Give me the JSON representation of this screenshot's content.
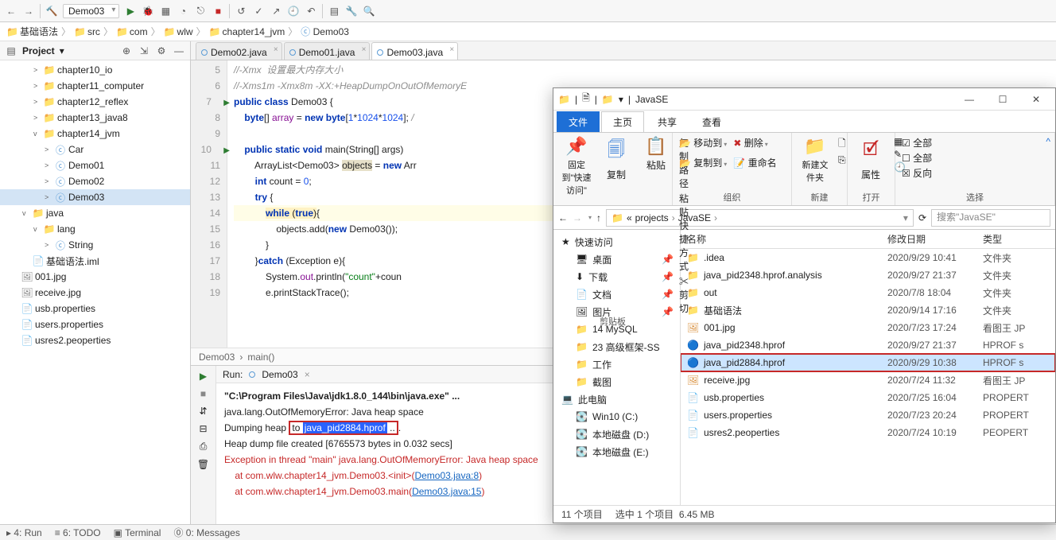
{
  "toolbar": {
    "run_config": "Demo03"
  },
  "breadcrumbs": [
    "基础语法",
    "src",
    "com",
    "wlw",
    "chapter14_jvm",
    "Demo03"
  ],
  "project": {
    "title": "Project",
    "tree": [
      {
        "depth": 3,
        "arrow": ">",
        "icon": "📁",
        "label": "chapter10_io"
      },
      {
        "depth": 3,
        "arrow": ">",
        "icon": "📁",
        "label": "chapter11_computer"
      },
      {
        "depth": 3,
        "arrow": ">",
        "icon": "📁",
        "label": "chapter12_reflex"
      },
      {
        "depth": 3,
        "arrow": ">",
        "icon": "📁",
        "label": "chapter13_java8"
      },
      {
        "depth": 3,
        "arrow": "v",
        "icon": "📁",
        "label": "chapter14_jvm"
      },
      {
        "depth": 4,
        "arrow": ">",
        "icon": "ⓒ",
        "label": "Car"
      },
      {
        "depth": 4,
        "arrow": ">",
        "icon": "ⓒ",
        "label": "Demo01"
      },
      {
        "depth": 4,
        "arrow": ">",
        "icon": "ⓒ",
        "label": "Demo02"
      },
      {
        "depth": 4,
        "arrow": ">",
        "icon": "ⓒ",
        "label": "Demo03",
        "sel": true
      },
      {
        "depth": 2,
        "arrow": "v",
        "icon": "📁",
        "label": "java"
      },
      {
        "depth": 3,
        "arrow": "v",
        "icon": "📁",
        "label": "lang"
      },
      {
        "depth": 4,
        "arrow": ">",
        "icon": "ⓒ",
        "label": "String"
      },
      {
        "depth": 2,
        "arrow": "",
        "icon": "📄",
        "label": "基础语法.iml"
      },
      {
        "depth": 1,
        "arrow": "",
        "icon": "🖼",
        "label": "001.jpg"
      },
      {
        "depth": 1,
        "arrow": "",
        "icon": "🖼",
        "label": "receive.jpg"
      },
      {
        "depth": 1,
        "arrow": "",
        "icon": "📄",
        "label": "usb.properties"
      },
      {
        "depth": 1,
        "arrow": "",
        "icon": "📄",
        "label": "users.properties"
      },
      {
        "depth": 1,
        "arrow": "",
        "icon": "📄",
        "label": "usres2.peoperties"
      }
    ]
  },
  "editor": {
    "tabs": [
      {
        "label": "Demo02.java"
      },
      {
        "label": "Demo01.java"
      },
      {
        "label": "Demo03.java",
        "active": true
      }
    ],
    "gutter_start": 5,
    "gutter_count": 15,
    "crumb": [
      "Demo03",
      "main()"
    ]
  },
  "run": {
    "title": "Run:",
    "config": "Demo03",
    "lines": [
      {
        "cls": "",
        "html": "<b>\"C:\\Program Files\\Java\\jdk1.8.0_144\\bin\\java.exe\" ...</b>"
      },
      {
        "cls": "",
        "html": "java.lang.OutOfMemoryError: Java heap space"
      },
      {
        "cls": "",
        "html": "Dumping heap <span class='boxed'>to <span class='sel-text'>java_pid2884.hprof</span> ..</span>."
      },
      {
        "cls": "",
        "html": "Heap dump file created [6765573 bytes in 0.032 secs]"
      },
      {
        "cls": "red",
        "html": "Exception in thread \"main\" java.lang.OutOfMemoryError: Java heap space"
      },
      {
        "cls": "red",
        "html": "    at com.wlw.chapter14_jvm.Demo03.&lt;init&gt;(<span class='link'>Demo03.java:8</span>)"
      },
      {
        "cls": "red",
        "html": "    at com.wlw.chapter14_jvm.Demo03.main(<span class='link'>Demo03.java:15</span>)"
      }
    ]
  },
  "explorer": {
    "title": "JavaSE",
    "ribbon_tabs": [
      "文件",
      "主页",
      "共享",
      "查看"
    ],
    "ribbon_groups": {
      "clipboard": {
        "pin": "固定到\"快速访问\"",
        "copy": "复制",
        "paste": "粘贴",
        "cp_path": "复制路径",
        "paste_sc": "粘贴快捷方式",
        "cut": "剪切",
        "label": "剪贴板"
      },
      "organize": {
        "move": "移动到",
        "copy_to": "复制到",
        "delete": "删除",
        "rename": "重命名",
        "label": "组织"
      },
      "new": {
        "folder": "新建文件夹",
        "label": "新建"
      },
      "open": {
        "props": "属性",
        "label": "打开"
      },
      "select": {
        "all": "全部",
        "none": "全部",
        "inv": "反向",
        "label": "选择"
      }
    },
    "path": [
      "« ",
      "projects",
      "JavaSE"
    ],
    "search_placeholder": "搜索\"JavaSE\"",
    "side": [
      {
        "icon": "★",
        "label": "快速访问",
        "indent": false
      },
      {
        "icon": "🖥",
        "label": "桌面",
        "indent": true,
        "pin": true
      },
      {
        "icon": "⬇",
        "label": "下载",
        "indent": true,
        "pin": true
      },
      {
        "icon": "📄",
        "label": "文档",
        "indent": true,
        "pin": true
      },
      {
        "icon": "🖼",
        "label": "图片",
        "indent": true,
        "pin": true
      },
      {
        "icon": "📁",
        "label": "14 MySQL",
        "indent": true
      },
      {
        "icon": "📁",
        "label": "23 高级框架-SS",
        "indent": true
      },
      {
        "icon": "📁",
        "label": "工作",
        "indent": true
      },
      {
        "icon": "📁",
        "label": "截图",
        "indent": true
      },
      {
        "icon": "💻",
        "label": "此电脑",
        "indent": false
      },
      {
        "icon": "💽",
        "label": "Win10 (C:)",
        "indent": true
      },
      {
        "icon": "💽",
        "label": "本地磁盘 (D:)",
        "indent": true
      },
      {
        "icon": "💽",
        "label": "本地磁盘 (E:)",
        "indent": true
      }
    ],
    "cols": {
      "name": "名称",
      "date": "修改日期",
      "type": "类型"
    },
    "files": [
      {
        "icon": "📁",
        "name": ".idea",
        "date": "2020/9/29 10:41",
        "type": "文件夹"
      },
      {
        "icon": "📁",
        "name": "java_pid2348.hprof.analysis",
        "date": "2020/9/27 21:37",
        "type": "文件夹"
      },
      {
        "icon": "📁",
        "name": "out",
        "date": "2020/7/8 18:04",
        "type": "文件夹"
      },
      {
        "icon": "📁",
        "name": "基础语法",
        "date": "2020/9/14 17:16",
        "type": "文件夹"
      },
      {
        "icon": "🖼",
        "name": "001.jpg",
        "date": "2020/7/23 17:24",
        "type": "看图王 JP"
      },
      {
        "icon": "🔵",
        "name": "java_pid2348.hprof",
        "date": "2020/9/27 21:37",
        "type": "HPROF s"
      },
      {
        "icon": "🔵",
        "name": "java_pid2884.hprof",
        "date": "2020/9/29 10:38",
        "type": "HPROF s",
        "sel": true,
        "box": true
      },
      {
        "icon": "🖼",
        "name": "receive.jpg",
        "date": "2020/7/24 11:32",
        "type": "看图王 JP"
      },
      {
        "icon": "📄",
        "name": "usb.properties",
        "date": "2020/7/25 16:04",
        "type": "PROPERT"
      },
      {
        "icon": "📄",
        "name": "users.properties",
        "date": "2020/7/23 20:24",
        "type": "PROPERT"
      },
      {
        "icon": "📄",
        "name": "usres2.peoperties",
        "date": "2020/7/24 10:19",
        "type": "PEOPERT"
      }
    ],
    "status": {
      "count": "11 个项目",
      "sel": "选中 1 个项目",
      "size": "6.45 MB"
    }
  }
}
